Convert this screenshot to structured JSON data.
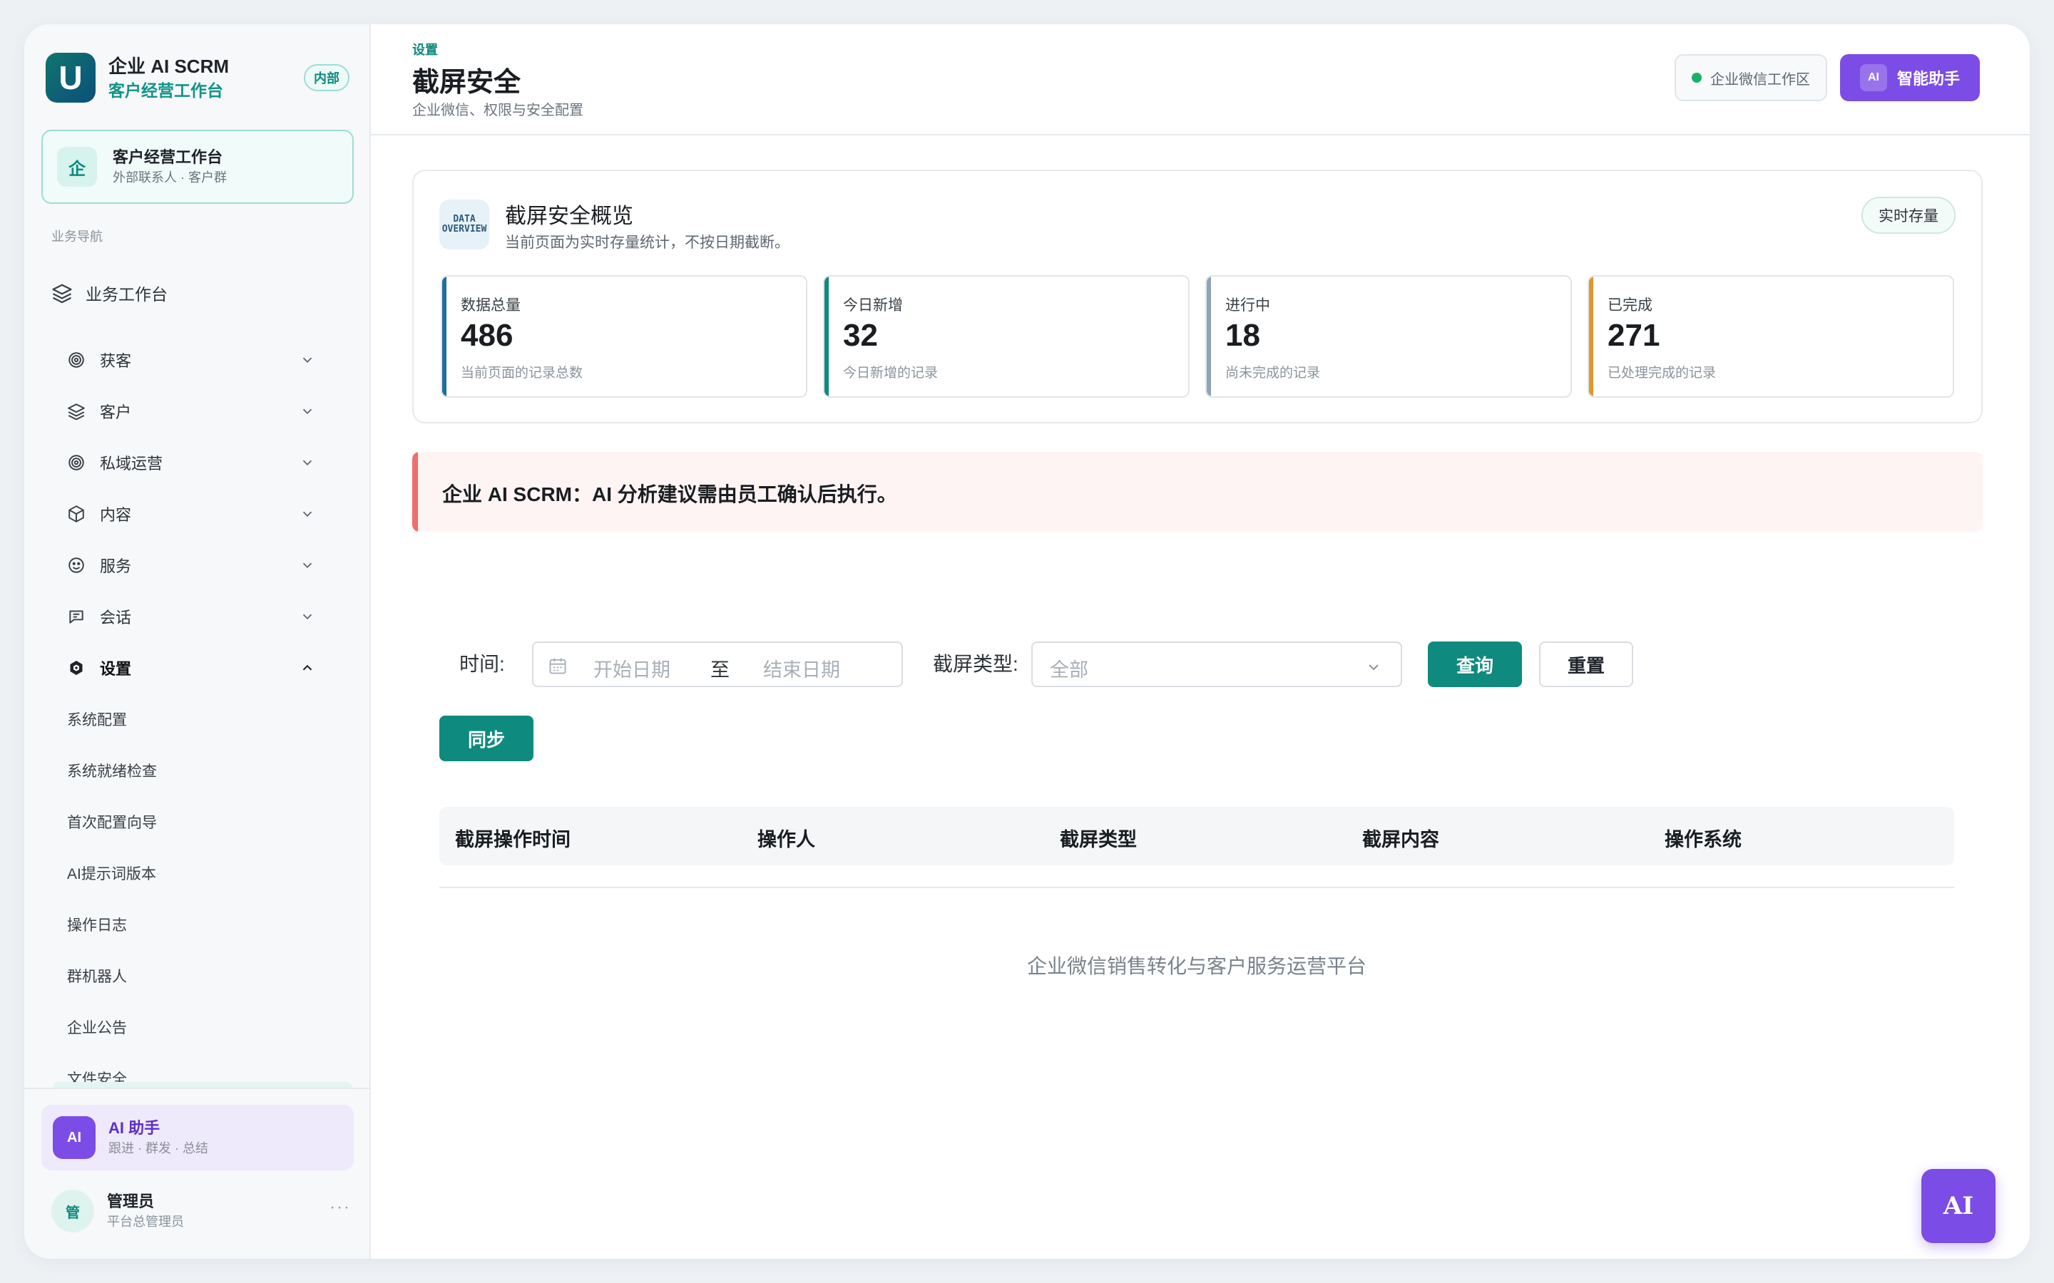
{
  "brand": {
    "title": "企业 AI SCRM",
    "subtitle": "客户经营工作台",
    "badge": "内部",
    "logo_letter": "U"
  },
  "workspace": {
    "icon_text": "企",
    "title": "客户经营工作台",
    "subtitle": "外部联系人 · 客户群"
  },
  "nav": {
    "section_label": "业务导航",
    "root": "业务工作台",
    "items": [
      {
        "label": "获客",
        "icon": "target-icon",
        "expanded": false
      },
      {
        "label": "客户",
        "icon": "layers-icon",
        "expanded": false
      },
      {
        "label": "私域运营",
        "icon": "target-icon",
        "expanded": false
      },
      {
        "label": "内容",
        "icon": "box-icon",
        "expanded": false
      },
      {
        "label": "服务",
        "icon": "smile-icon",
        "expanded": false
      },
      {
        "label": "会话",
        "icon": "chat-icon",
        "expanded": false
      },
      {
        "label": "设置",
        "icon": "settings-icon",
        "expanded": true
      }
    ],
    "sub_items": [
      "系统配置",
      "系统就绪检查",
      "首次配置向导",
      "AI提示词版本",
      "操作日志",
      "群机器人",
      "企业公告",
      "文件安全"
    ]
  },
  "ai_card": {
    "badge": "AI",
    "title": "AI 助手",
    "subtitle": "跟进 · 群发 · 总结"
  },
  "user": {
    "avatar_text": "管",
    "name": "管理员",
    "role": "平台总管理员",
    "more": "···"
  },
  "header": {
    "breadcrumb": "设置",
    "title": "截屏安全",
    "subtitle": "企业微信、权限与安全配置",
    "env_label": "企业微信工作区",
    "assistant_badge": "AI",
    "assistant_label": "智能助手"
  },
  "overview": {
    "icon_line1": "DATA",
    "icon_line2": "OVERVIEW",
    "title": "截屏安全概览",
    "subtitle": "当前页面为实时存量统计，不按日期截断。",
    "chip": "实时存量",
    "stats": [
      {
        "label": "数据总量",
        "value": "486",
        "note": "当前页面的记录总数",
        "color": "#1f6f9a"
      },
      {
        "label": "今日新增",
        "value": "32",
        "note": "今日新增的记录",
        "color": "#0f8a7e"
      },
      {
        "label": "进行中",
        "value": "18",
        "note": "尚未完成的记录",
        "color": "#8fa3bc"
      },
      {
        "label": "已完成",
        "value": "271",
        "note": "已处理完成的记录",
        "color": "#e0962a"
      }
    ]
  },
  "alert": {
    "text": "企业 AI SCRM：AI 分析建议需由员工确认后执行。"
  },
  "filter": {
    "time_label": "时间:",
    "start_placeholder": "开始日期",
    "range_sep": "至",
    "end_placeholder": "结束日期",
    "type_label": "截屏类型:",
    "type_value": "全部",
    "query_button": "查询",
    "reset_button": "重置",
    "sync_button": "同步"
  },
  "table": {
    "columns": [
      "截屏操作时间",
      "操作人",
      "截屏类型",
      "截屏内容",
      "操作系统"
    ],
    "empty_text": "企业微信销售转化与客户服务运营平台"
  },
  "fab": {
    "label": "AI"
  }
}
